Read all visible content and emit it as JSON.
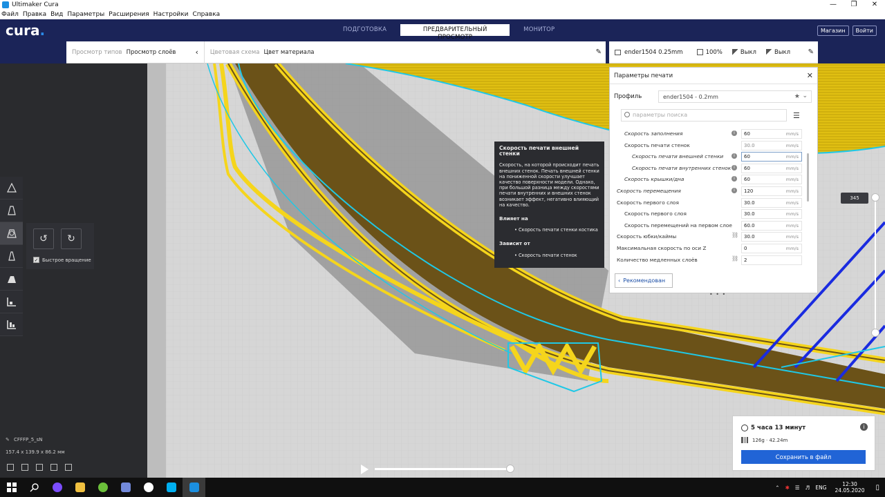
{
  "window": {
    "title": "Ultimaker Cura",
    "controls": [
      "—",
      "❐",
      "✕"
    ]
  },
  "menu": [
    "Файл",
    "Правка",
    "Вид",
    "Параметры",
    "Расширения",
    "Настройки",
    "Справка"
  ],
  "header": {
    "logo": "cura",
    "stages": [
      "ПОДГОТОВКА",
      "ПРЕДВАРИТЕЛЬНЫЙ ПРОСМОТР",
      "МОНИТОР"
    ],
    "active_stage": 1,
    "marketplace": "Магазин",
    "signin": "Войти"
  },
  "viewbar": {
    "view_type_label": "Просмотр типов",
    "view_type_value": "Просмотр слоёв",
    "color_scheme_label": "Цветовая схема",
    "color_scheme_value": "Цвет материала"
  },
  "printerbar": {
    "printer": "ender1504 0.25mm",
    "infill": "100%",
    "support": "Выкл",
    "adhesion": "Выкл"
  },
  "panel": {
    "title": "Параметры печати",
    "profile_label": "Профиль",
    "profile_value": "ender1504 - 0.2mm",
    "search_placeholder": "параметры поиска",
    "recommended_button": "Рекомендован",
    "settings": [
      {
        "label": "Скорость заполнения",
        "value": "60",
        "unit": "mm/s",
        "indent": 1,
        "italic": true,
        "badge": "i"
      },
      {
        "label": "Скорость печати стенок",
        "value": "30.0",
        "unit": "mm/s",
        "indent": 1,
        "italic": false,
        "badge": "",
        "dim": true
      },
      {
        "label": "Скорость печати внешней стенки",
        "value": "60",
        "unit": "mm/s",
        "indent": 2,
        "italic": true,
        "badge": "i",
        "highlight": true
      },
      {
        "label": "Скорость печати внутренних стенок",
        "value": "60",
        "unit": "mm/s",
        "indent": 2,
        "italic": true,
        "badge": "i"
      },
      {
        "label": "Скорость крышки/дна",
        "value": "60",
        "unit": "mm/s",
        "indent": 1,
        "italic": true,
        "badge": "i"
      },
      {
        "label": "Скорость перемещения",
        "value": "120",
        "unit": "mm/s",
        "indent": 0,
        "italic": true,
        "badge": "i"
      },
      {
        "label": "Скорость первого слоя",
        "value": "30.0",
        "unit": "mm/s",
        "indent": 0,
        "italic": false,
        "badge": ""
      },
      {
        "label": "Скорость первого слоя",
        "value": "30.0",
        "unit": "mm/s",
        "indent": 1,
        "italic": false,
        "badge": ""
      },
      {
        "label": "Скорость перемещений на первом слое",
        "value": "60.0",
        "unit": "mm/s",
        "indent": 1,
        "italic": false,
        "badge": ""
      },
      {
        "label": "Скорость юбки/каймы",
        "value": "30.0",
        "unit": "mm/s",
        "indent": 0,
        "italic": false,
        "badge": "link"
      },
      {
        "label": "Максимальная скорость по оси Z",
        "value": "0",
        "unit": "mm/s",
        "indent": 0,
        "italic": false,
        "badge": ""
      },
      {
        "label": "Количество медленных слоёв",
        "value": "2",
        "unit": "",
        "indent": 0,
        "italic": false,
        "badge": "link"
      }
    ]
  },
  "tooltip": {
    "title": "Скорость печати внешней стенки",
    "body": "Скорость, на которой происходит печать внешних стенок. Печать внешней стенки на пониженной скорости улучшает качество поверхности модели. Однако, при большой разница между скоростями печати внутренних и внешних стенок возникает эффект, негативно влияющий на качество.",
    "affects_heading": "Влияет на",
    "affects_item": "• Скорость печати стенки костика",
    "depends_heading": "Зависит от",
    "depends_item": "• Скорость печати стенок"
  },
  "rotate_panel": {
    "checkbox_label": "Быстрое вращение",
    "checked": true
  },
  "object": {
    "name": "CFFFP_5_sN",
    "dimensions": "157.4 x 139.9 x 86.2 мм"
  },
  "layer": {
    "current": "345"
  },
  "output": {
    "time": "5 часа 13 минут",
    "material": "126g · 42.24m",
    "save_button": "Сохранить в файл"
  },
  "taskbar": {
    "language": "ENG",
    "time": "12:30",
    "date": "24.05.2020"
  },
  "colors": {
    "header_bg": "#1b2458",
    "accent_blue": "#2164d6",
    "print_yellow": "#f5d51c",
    "shell_cyan": "#1fc8e6",
    "travel_blue": "#1a2be0"
  }
}
